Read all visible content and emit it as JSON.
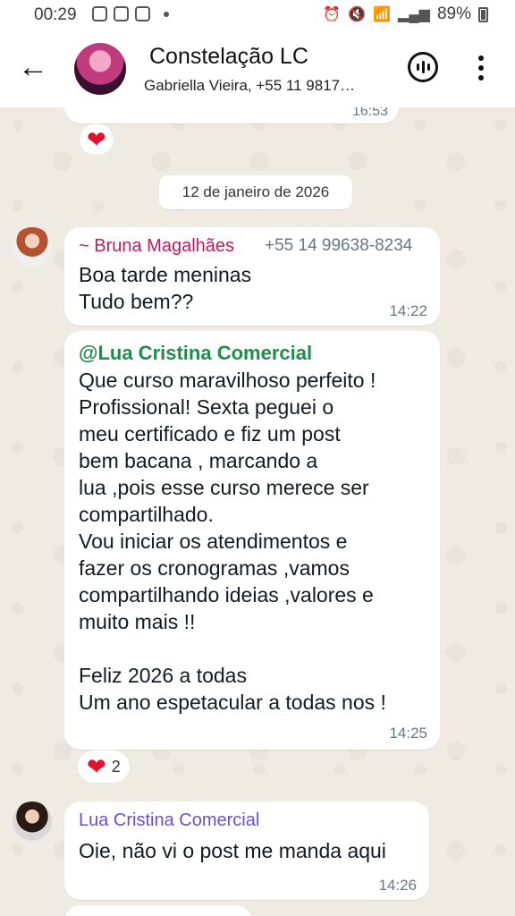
{
  "status_bar": {
    "time": "00:29",
    "battery": "89%"
  },
  "header": {
    "title": "Constelação LC",
    "subtitle": "Gabriella Vieira, +55 11 9817…"
  },
  "chat": {
    "previous_time": "16:53",
    "date_chip": "12 de janeiro de 2026",
    "messages": [
      {
        "sender": "~ Bruna Magalhães",
        "phone": "+55 14 99638-8234",
        "text": "Boa tarde meninas\nTudo bem??",
        "time": "14:22"
      },
      {
        "mention": "@Lua Cristina Comercial",
        "text": "Que curso maravilhoso perfeito !\nProfissional!  Sexta peguei o\nmeu certificado e fiz um post\nbem bacana , marcando a\nlua ,pois esse curso merece ser\ncompartilhado.\nVou iniciar os atendimentos e\nfazer os cronogramas ,vamos\ncompartilhando ideias ,valores e\nmuito mais !!\n\nFeliz 2026 a todas\nUm ano espetacular a todas nos !",
        "time": "14:25",
        "reaction_count": "2"
      },
      {
        "sender": "Lua Cristina Comercial",
        "text": "Oie, não vi o post me manda aqui",
        "time": "14:26"
      }
    ]
  },
  "colors": {
    "sender_bruna": "#c2185b",
    "mention": "#1f8b4c",
    "sender_lua": "#6a4fd1",
    "heart": "#e0142e"
  }
}
